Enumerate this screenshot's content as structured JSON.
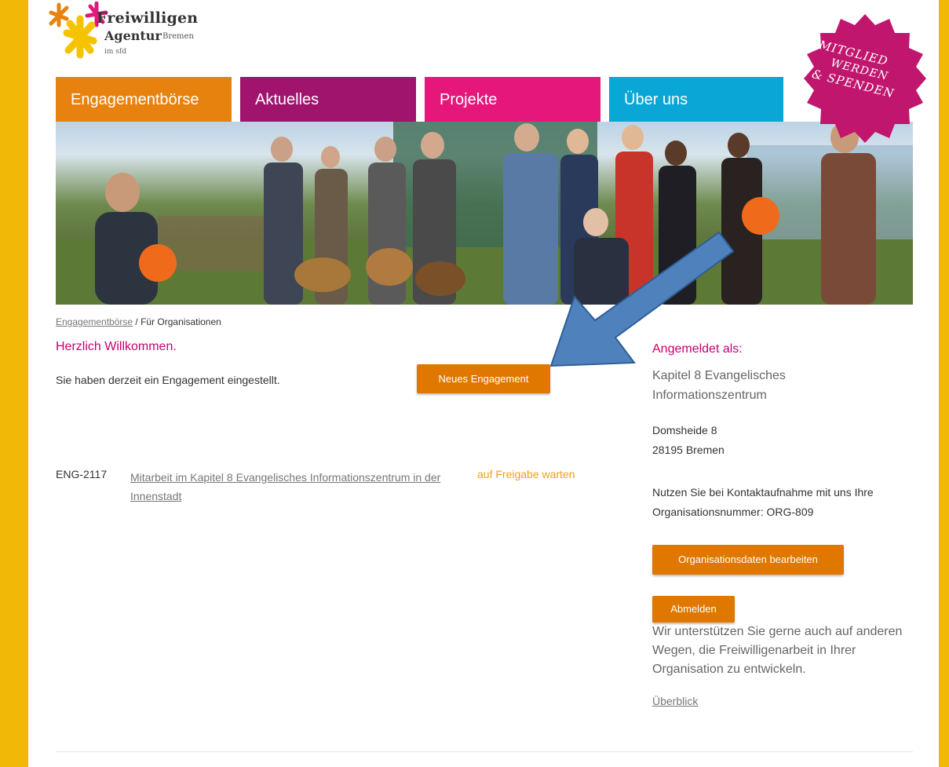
{
  "logo": {
    "line1": "Freiwilligen",
    "line2": "Agentur",
    "city": "Bremen",
    "sub": "im sfd"
  },
  "nav": [
    {
      "label": "Engagementbörse",
      "color": "#e8820e"
    },
    {
      "label": "Aktuelles",
      "color": "#a0146e"
    },
    {
      "label": "Projekte",
      "color": "#e5177b"
    },
    {
      "label": "Über uns",
      "color": "#0aa6d6"
    }
  ],
  "badge": {
    "line1": "MITGLIED",
    "line2": "WERDEN",
    "line3": "& SPENDEN",
    "color": "#c0166e"
  },
  "breadcrumb": {
    "link": "Engagementbörse",
    "separator": " / ",
    "current": "Für Organisationen"
  },
  "main": {
    "welcome": "Herzlich Willkommen.",
    "intro": "Sie haben derzeit ein Engagement eingestellt.",
    "new_button": "Neues Engagement",
    "engagements": [
      {
        "id": "ENG-2117",
        "title": "Mitarbeit im Kapitel 8 Evangelisches Informationszentrum in der Innenstadt",
        "status": "auf Freigabe warten"
      }
    ]
  },
  "sidebar": {
    "title": "Angemeldet als:",
    "org_name": "Kapitel 8 Evangelisches Informationszentrum",
    "address_line1": "Domsheide 8",
    "address_line2": "28195 Bremen",
    "contact_note": "Nutzen Sie bei Kontaktaufnahme mit uns Ihre Organisationsnummer: ORG-809",
    "edit_button": "Organisationsdaten bearbeiten",
    "logout_button": "Abmelden",
    "support_text": "Wir unterstützen Sie gerne auch auf anderen Wegen, die Freiwilligenarbeit in Ihrer Organisation zu entwickeln.",
    "overview_link": "Überblick"
  },
  "colors": {
    "frame": "#f2b807",
    "accent_orange": "#e07800",
    "magenta": "#c8006c",
    "status": "#f0a014",
    "arrow": "#4f81bd"
  }
}
